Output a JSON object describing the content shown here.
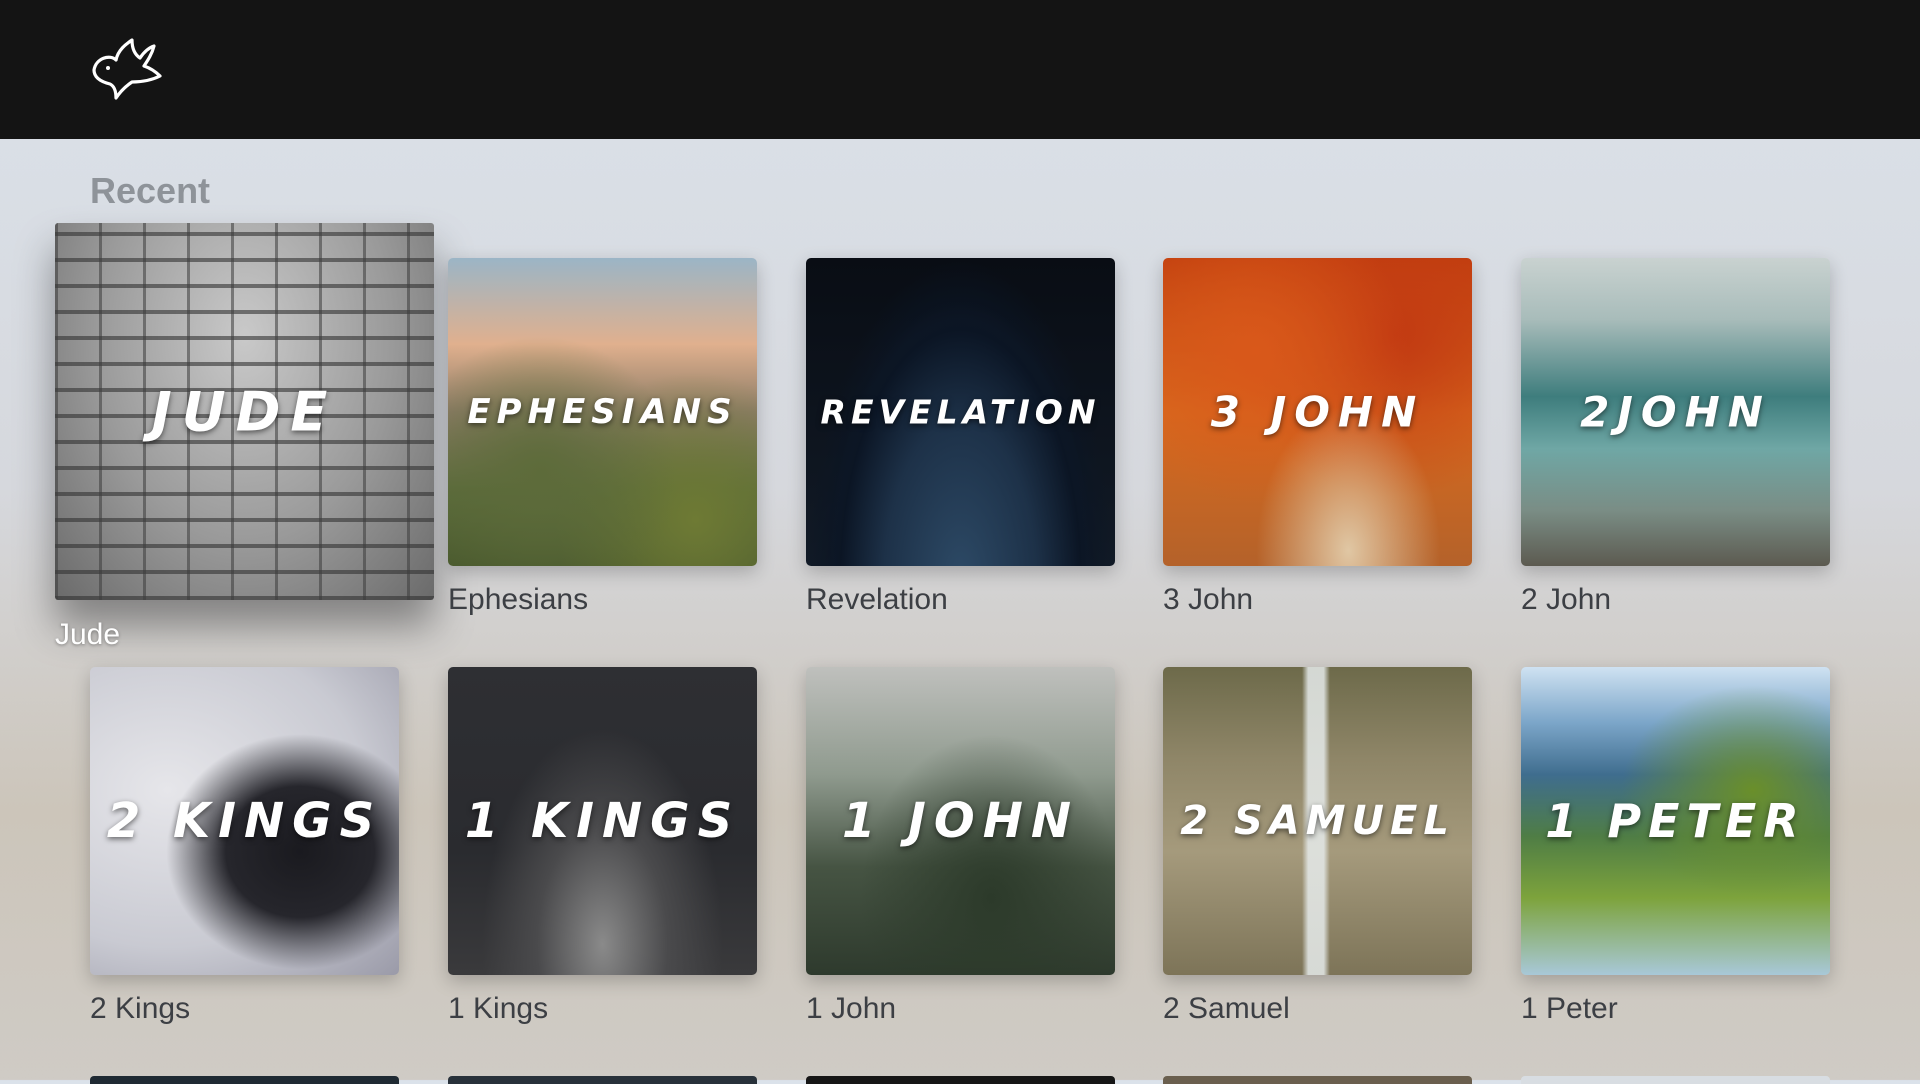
{
  "app": {
    "logo_icon": "dove-icon"
  },
  "section": {
    "title": "Recent"
  },
  "tiles": [
    {
      "art_text": "JUDE",
      "caption": "Jude",
      "focused": true
    },
    {
      "art_text": "EPHESIANS",
      "caption": "Ephesians"
    },
    {
      "art_text": "REVELATION",
      "caption": "Revelation"
    },
    {
      "art_text": "3 JOHN",
      "caption": "3 John"
    },
    {
      "art_text": "2JOHN",
      "caption": "2 John"
    },
    {
      "art_text": "2 KINGS",
      "caption": "2 Kings"
    },
    {
      "art_text": "1 KINGS",
      "caption": "1 Kings"
    },
    {
      "art_text": "1 JOHN",
      "caption": "1 John"
    },
    {
      "art_text": "2 SAMUEL",
      "caption": "2 Samuel"
    },
    {
      "art_text": "1 PETER",
      "caption": "1 Peter"
    }
  ],
  "colors": {
    "topbar": "#141414",
    "section_title": "#8e9399",
    "caption": "#3c3f44",
    "focused_caption": "#ffffff"
  }
}
